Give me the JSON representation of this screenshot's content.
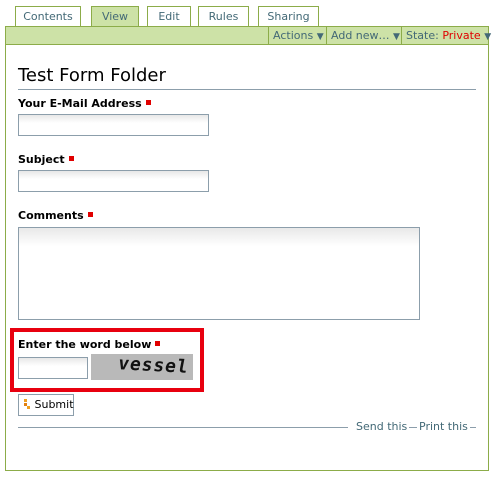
{
  "tabs": [
    {
      "label": "Contents"
    },
    {
      "label": "View",
      "active": true
    },
    {
      "label": "Edit"
    },
    {
      "label": "Rules"
    },
    {
      "label": "Sharing"
    }
  ],
  "actionbar": {
    "actions_label": "Actions",
    "add_new_label": "Add new…",
    "state_prefix": "State:",
    "state_value": "Private",
    "arrow": "▼"
  },
  "page": {
    "title": "Test Form Folder"
  },
  "form": {
    "email_label": "Your E-Mail Address",
    "subject_label": "Subject",
    "comments_label": "Comments",
    "captcha_label": "Enter the word below",
    "captcha_word": "vessel",
    "submit_label": "Submit"
  },
  "document_actions": {
    "send_this": "Send this",
    "print_this": "Print this"
  },
  "colors": {
    "accent_green": "#cde2a7",
    "border_green": "#8cac49",
    "link_blue": "#436976",
    "required_red": "#e00000",
    "highlight_red": "#e8000f"
  },
  "icons": [
    "chevron-down-icon",
    "required-marker-icon",
    "submit-icon"
  ]
}
